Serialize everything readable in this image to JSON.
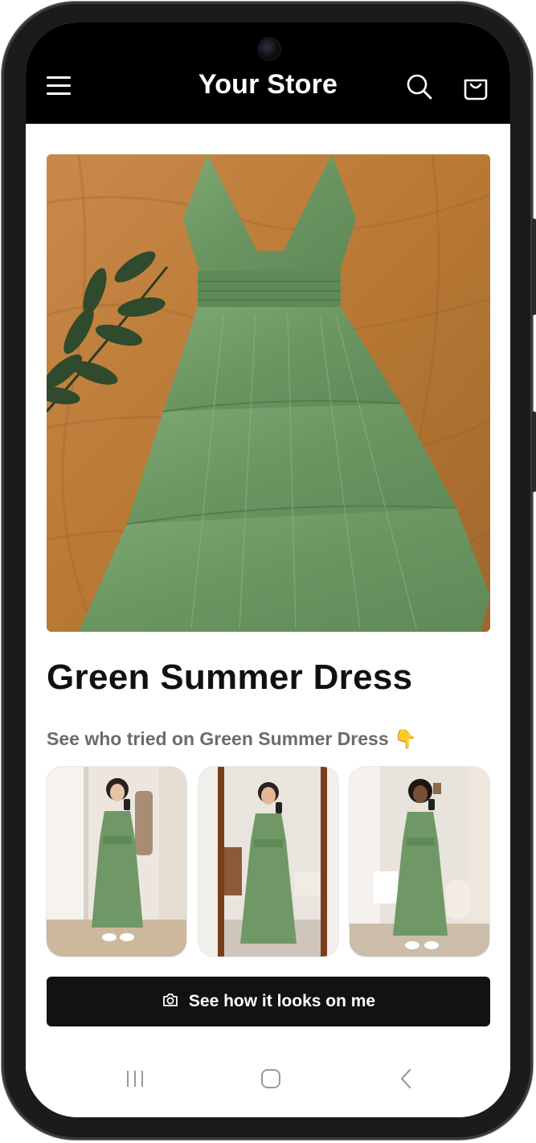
{
  "header": {
    "store_title": "Your Store",
    "menu_icon": "hamburger-menu-icon",
    "search_icon": "search-icon",
    "cart_icon": "shopping-bag-icon",
    "background": "#000000"
  },
  "product": {
    "title": "Green Summer Dress",
    "image_alt": "Green tiered summer dress laid flat on a tan fabric with a leaf sprig",
    "dress_color": "#6f9866"
  },
  "try_on": {
    "heading": "See who tried on Green Summer Dress 👇",
    "photos": [
      {
        "alt": "Mirror selfie of a woman in the green dress, white sneakers"
      },
      {
        "alt": "Mirror selfie of a woman in the green dress, bare feet"
      },
      {
        "alt": "Mirror selfie of a woman in the green dress, white sneakers"
      }
    ]
  },
  "cta": {
    "label": "See how it looks on me",
    "icon": "camera-icon"
  },
  "system_nav": {
    "recents_icon": "recents-icon",
    "home_icon": "home-icon",
    "back_icon": "back-icon"
  }
}
